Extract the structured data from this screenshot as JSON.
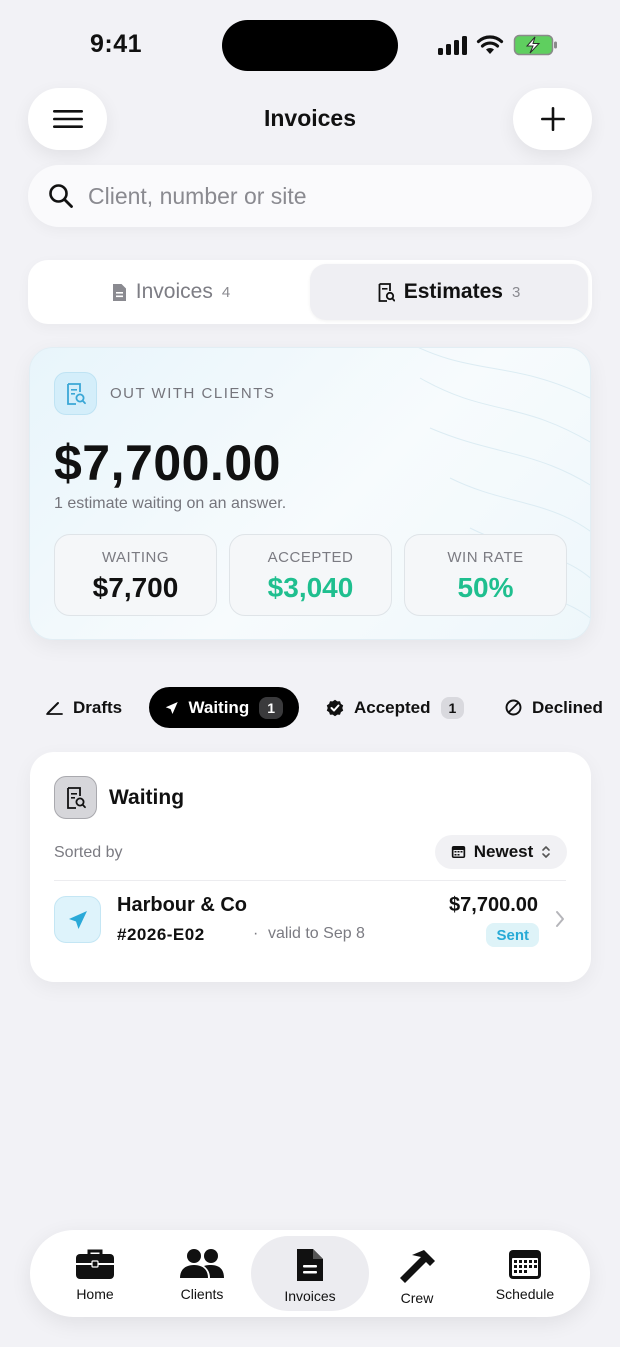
{
  "status_bar": {
    "time": "9:41"
  },
  "header": {
    "title": "Invoices"
  },
  "search": {
    "placeholder": "Client, number or site"
  },
  "segments": [
    {
      "label": "Invoices",
      "count": "4",
      "active": false
    },
    {
      "label": "Estimates",
      "count": "3",
      "active": true
    }
  ],
  "summary": {
    "label": "OUT WITH CLIENTS",
    "amount": "$7,700.00",
    "subtitle": "1 estimate waiting on an answer.",
    "stats": [
      {
        "label": "WAITING",
        "value": "$7,700"
      },
      {
        "label": "ACCEPTED",
        "value": "$3,040"
      },
      {
        "label": "WIN RATE",
        "value": "50%"
      }
    ]
  },
  "filters": [
    {
      "label": "Drafts",
      "badge": ""
    },
    {
      "label": "Waiting",
      "badge": "1"
    },
    {
      "label": "Accepted",
      "badge": "1"
    },
    {
      "label": "Declined",
      "badge": ""
    }
  ],
  "list": {
    "title": "Waiting",
    "sorted_by_label": "Sorted by",
    "sort_value": "Newest",
    "rows": [
      {
        "client": "Harbour & Co",
        "number": "#2026-E02",
        "separator": "·",
        "valid": "valid to Sep 8",
        "amount": "$7,700.00",
        "status": "Sent"
      }
    ]
  },
  "tabbar": [
    {
      "label": "Home",
      "icon": "briefcase-icon"
    },
    {
      "label": "Clients",
      "icon": "people-icon"
    },
    {
      "label": "Invoices",
      "icon": "document-icon"
    },
    {
      "label": "Crew",
      "icon": "hammer-icon"
    },
    {
      "label": "Schedule",
      "icon": "calendar-icon"
    }
  ],
  "colors": {
    "accent_green": "#1fbf8f",
    "sent_blue": "#27aad6",
    "background": "#f2f2f6"
  }
}
